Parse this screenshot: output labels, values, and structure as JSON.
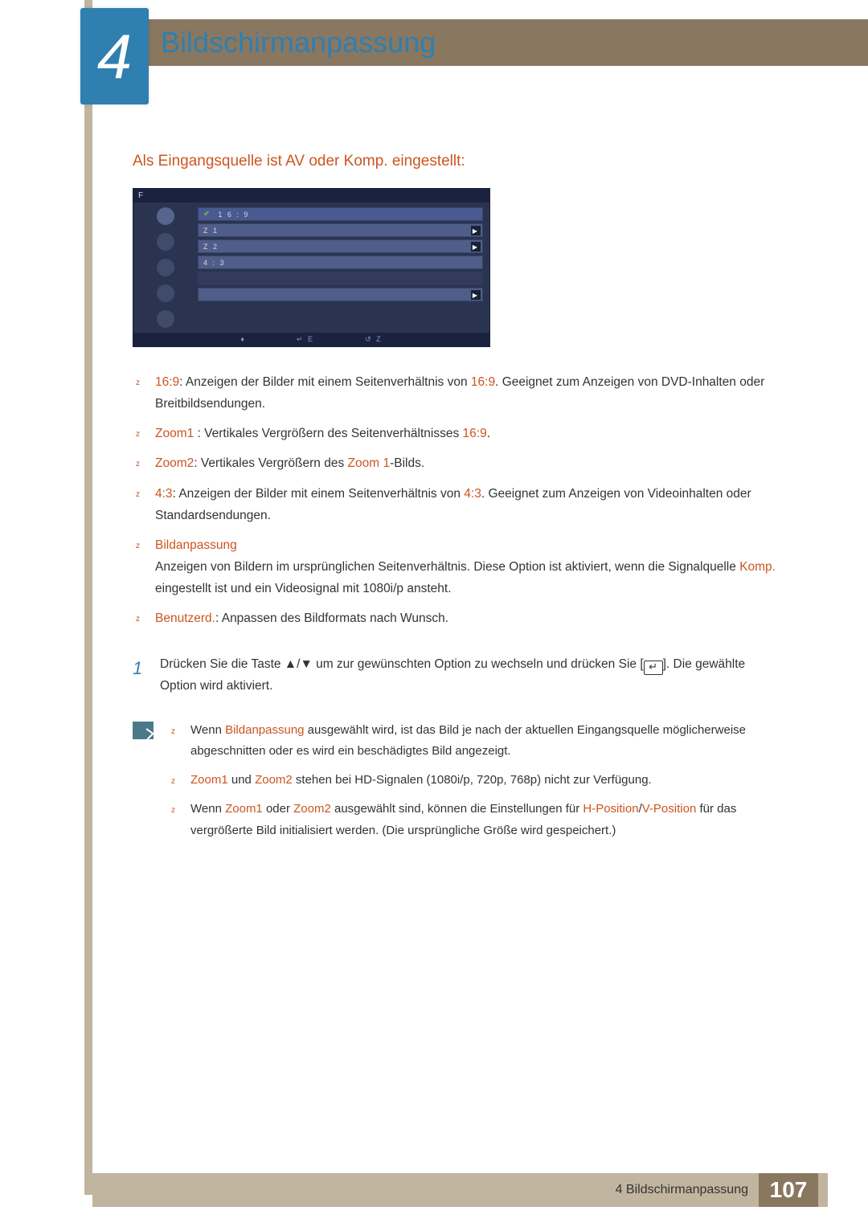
{
  "chapter": {
    "number": "4",
    "title": "Bildschirmanpassung"
  },
  "section_heading": "Als Eingangsquelle ist AV oder Komp. eingestellt:",
  "osd": {
    "title": "F",
    "rows": {
      "r0": "1 6 : 9",
      "r1": "Z           1",
      "r2": "Z           2",
      "r3": "4   :  3",
      "r4": " ",
      "r5": " "
    },
    "footer_left": " ",
    "footer_mid": "E",
    "footer_right": "Z"
  },
  "bullets": {
    "b1_hl1": "16:9",
    "b1_text1": ": Anzeigen der Bilder mit einem Seitenverhältnis von ",
    "b1_hl2": "16:9",
    "b1_text2": ". Geeignet zum Anzeigen von DVD-Inhalten oder Breitbildsendungen.",
    "b2_hl1": "Zoom1",
    "b2_text1": " : Vertikales Vergrößern des Seitenverhältnisses ",
    "b2_hl2": "16:9",
    "b2_text2": ".",
    "b3_hl1": "Zoom2",
    "b3_text1": ": Vertikales Vergrößern des ",
    "b3_hl2": "Zoom 1",
    "b3_text2": "-Bilds.",
    "b4_hl1": "4:3",
    "b4_text1": ": Anzeigen der Bilder mit einem Seitenverhältnis von ",
    "b4_hl2": "4:3",
    "b4_text2": ". Geeignet zum Anzeigen von Videoinhalten oder Standardsendungen.",
    "b5_hl1": "Bildanpassung",
    "b5_line1": "Anzeigen von Bildern im ursprünglichen Seitenverhältnis. Diese Option ist aktiviert, wenn die Signalquelle ",
    "b5_hl2": "Komp.",
    "b5_line2": " eingestellt ist und ein Videosignal mit 1080i/p ansteht.",
    "b6_hl1": "Benutzerd.",
    "b6_text1": ": Anpassen des Bildformats nach Wunsch."
  },
  "step": {
    "num": "1",
    "text1": "Drücken Sie die Taste ▲/▼ um zur gewünschten Option zu wechseln und drücken Sie [",
    "text2": "]. Die gewählte Option wird aktiviert."
  },
  "notes": {
    "n1_a": "Wenn ",
    "n1_hl": "Bildanpassung",
    "n1_b": " ausgewählt wird, ist das Bild je nach der aktuellen Eingangsquelle möglicherweise abgeschnitten oder es wird ein beschädigtes Bild angezeigt.",
    "n2_hl1": "Zoom1",
    "n2_mid": " und ",
    "n2_hl2": "Zoom2",
    "n2_b": " stehen bei HD-Signalen (1080i/p, 720p, 768p) nicht zur Verfügung.",
    "n3_a": "Wenn ",
    "n3_hl1": "Zoom1",
    "n3_mid": " oder ",
    "n3_hl2": "Zoom2",
    "n3_b": " ausgewählt sind, können die Einstellungen für ",
    "n3_hl3": "H-Position",
    "n3_slash": "/",
    "n3_hl4": "V-Position",
    "n3_c": " für das vergrößerte Bild initialisiert werden. (Die ursprüngliche Größe wird gespeichert.)"
  },
  "footer": {
    "text": "4 Bildschirmanpassung",
    "page": "107"
  }
}
